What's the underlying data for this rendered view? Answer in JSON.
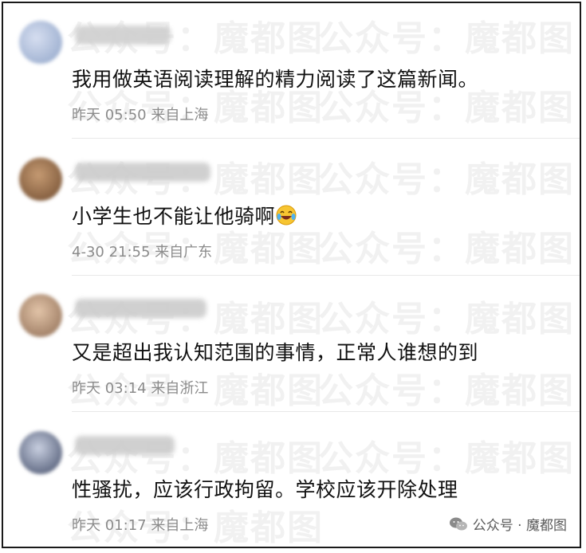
{
  "comments": [
    {
      "text": "我用做英语阅读理解的精力阅读了这篇新闻。",
      "meta": "昨天 05:50 来自上海",
      "avatar_color": "#b9c7dd",
      "has_emoji": false,
      "emoji": ""
    },
    {
      "text": "小学生也不能让他骑啊",
      "meta": "4-30 21:55 来自广东",
      "avatar_color": "#a57a55",
      "has_emoji": true,
      "emoji": "laughing-tears-emoji"
    },
    {
      "text": "又是超出我认知范围的事情，正常人谁想的到",
      "meta": "昨天 03:14 来自浙江",
      "avatar_color": "#b9957a",
      "has_emoji": false,
      "emoji": ""
    },
    {
      "text": "性骚扰，应该行政拘留。学校应该开除处理",
      "meta": "昨天 01:17 来自上海",
      "avatar_color": "#6f7fa0",
      "has_emoji": false,
      "emoji": ""
    }
  ],
  "watermark": {
    "text": "公众号：魔都图",
    "brand_text": "公众号 · 魔都图",
    "brand_icon": "wechat-icon"
  }
}
